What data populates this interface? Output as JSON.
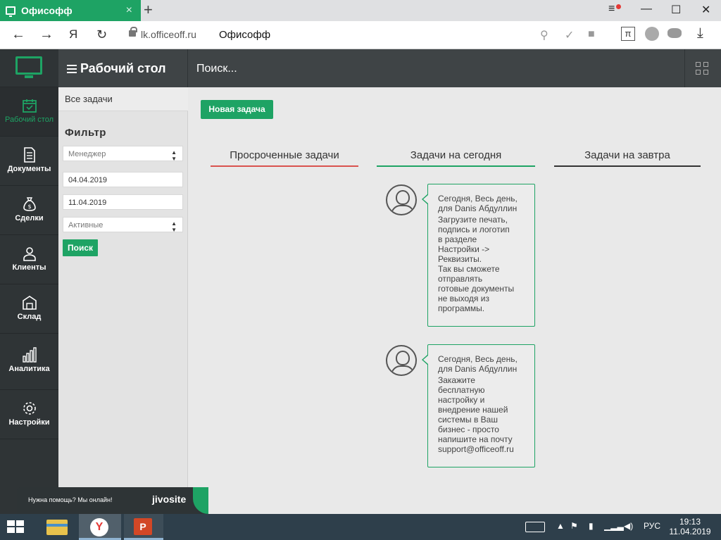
{
  "browser": {
    "tab_title": "Офисофф",
    "url": "lk.officeoff.ru",
    "page_title": "Офисофф",
    "yandex_label": "Я",
    "new_tab": "+",
    "close": "×",
    "win_controls": [
      "≡",
      "—",
      "☐",
      "✕"
    ]
  },
  "app": {
    "brand_color": "#1ea364",
    "top_title": "Рабочий стол",
    "search_placeholder": "Поиск...",
    "nav": [
      {
        "label": "Рабочий стол",
        "icon": "calendar-icon",
        "active": true
      },
      {
        "label": "Документы",
        "icon": "document-icon"
      },
      {
        "label": "Сделки",
        "icon": "money-bag-icon"
      },
      {
        "label": "Клиенты",
        "icon": "client-icon"
      },
      {
        "label": "Склад",
        "icon": "warehouse-icon"
      },
      {
        "label": "Аналитика",
        "icon": "chart-icon"
      },
      {
        "label": "Настройки",
        "icon": "gear-icon"
      }
    ]
  },
  "filter": {
    "all_tasks": "Все задачи",
    "title": "Фильтр",
    "manager": "Менеджер",
    "date_from": "04.04.2019",
    "date_to": "11.04.2019",
    "status": "Активные",
    "search_button": "Поиск"
  },
  "main": {
    "new_task": "Новая задача",
    "columns": [
      {
        "label": "Просроченные задачи",
        "color": "#d9534f"
      },
      {
        "label": "Задачи на сегодня",
        "color": "#1ea364"
      },
      {
        "label": "Задачи на завтра",
        "color": "#333333"
      }
    ],
    "tasks": [
      {
        "meta": "Сегодня, Весь день,\nдля Danis Абдуллин",
        "body": "Загрузите печать,\nподпись и логотип\nв разделе\nНастройки ->\nРеквизиты.\nТак вы сможете\nотправлять\nготовые документы\nне выходя из\nпрограммы."
      },
      {
        "meta": "Сегодня, Весь день,\nдля Danis Абдуллин",
        "body": "Закажите\nбесплатную\nнастройку и\nвнедрение нашей\nсистемы в Ваш\nбизнес - просто\nнапишите на почту\nsupport@officeoff.ru"
      }
    ]
  },
  "jivo": {
    "text": "Нужна помощь? Мы онлайн!",
    "logo": "jivosite"
  },
  "taskbar": {
    "lang": "РУС",
    "time": "19:13",
    "date": "11.04.2019"
  }
}
